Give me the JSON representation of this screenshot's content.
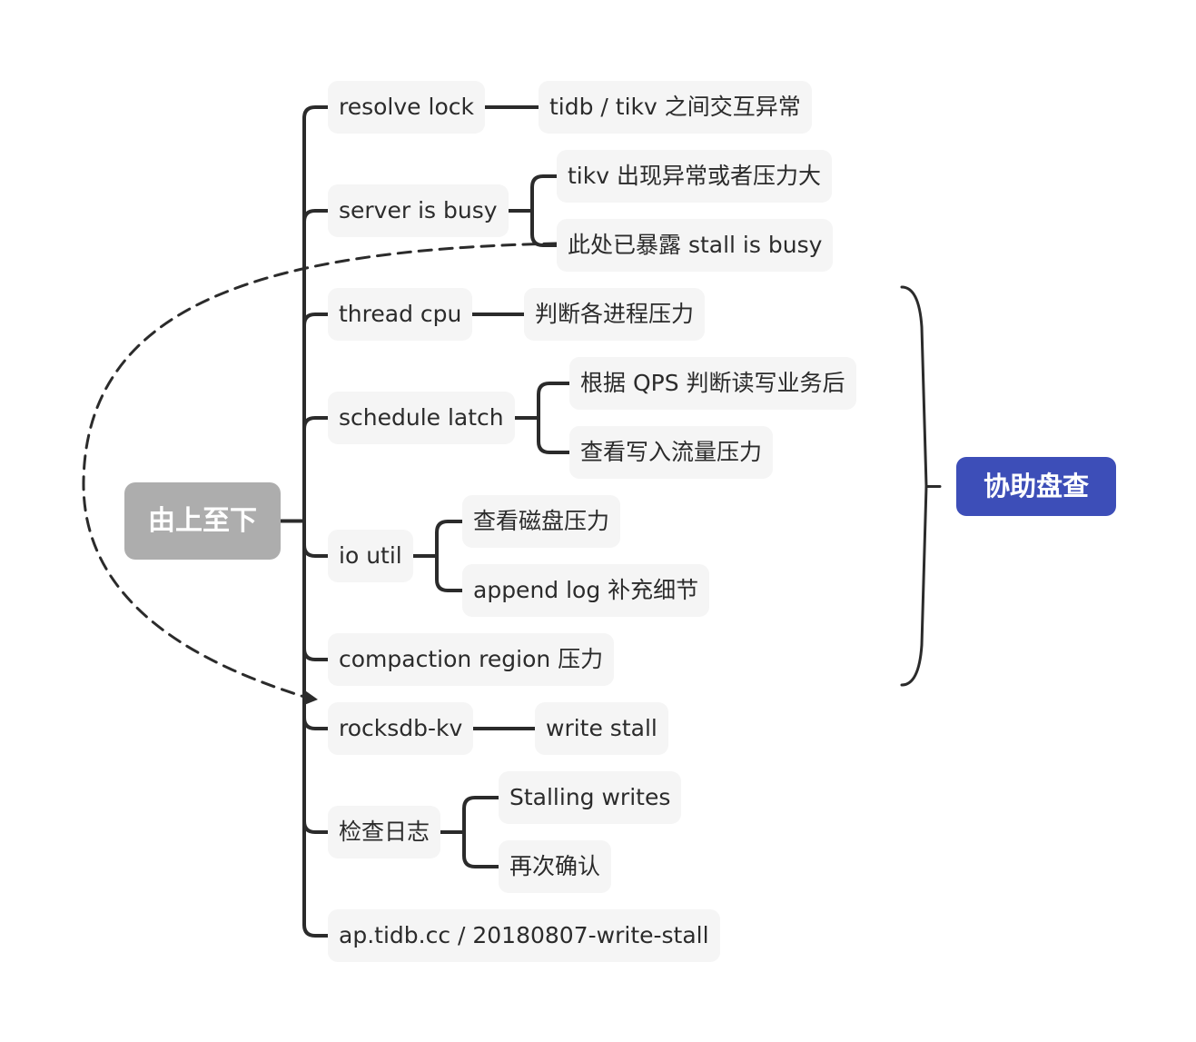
{
  "root": {
    "label": "由上至下",
    "color": "#adadad"
  },
  "summary": {
    "label": "协助盘查",
    "color": "#3d4eb8"
  },
  "branches": [
    {
      "label": "resolve lock",
      "children": [
        "tidb / tikv 之间交互异常"
      ]
    },
    {
      "label": "server is busy",
      "children": [
        "tikv 出现异常或者压力大",
        "此处已暴露 stall is busy"
      ]
    },
    {
      "label": "thread cpu",
      "children": [
        "判断各进程压力"
      ]
    },
    {
      "label": "schedule latch",
      "children": [
        "根据 QPS 判断读写业务后",
        "查看写入流量压力"
      ]
    },
    {
      "label": "io util",
      "children": [
        "查看磁盘压力",
        "append log 补充细节"
      ]
    },
    {
      "label": "compaction region 压力",
      "children": []
    },
    {
      "label": "rocksdb-kv",
      "children": [
        "write stall"
      ]
    },
    {
      "label": "检查日志",
      "children": [
        "Stalling writes",
        "再次确认"
      ]
    },
    {
      "label": "ap.tidb.cc / 20180807-write-stall",
      "children": []
    }
  ],
  "relationship": {
    "from": "此处已暴露 stall is busy",
    "to": "rocksdb-kv",
    "style": "dashed-arrow"
  },
  "summary_range": {
    "from": "thread cpu",
    "to": "compaction region 压力"
  },
  "line_color": "#2b2b2b",
  "node_bg": "#f5f5f5"
}
